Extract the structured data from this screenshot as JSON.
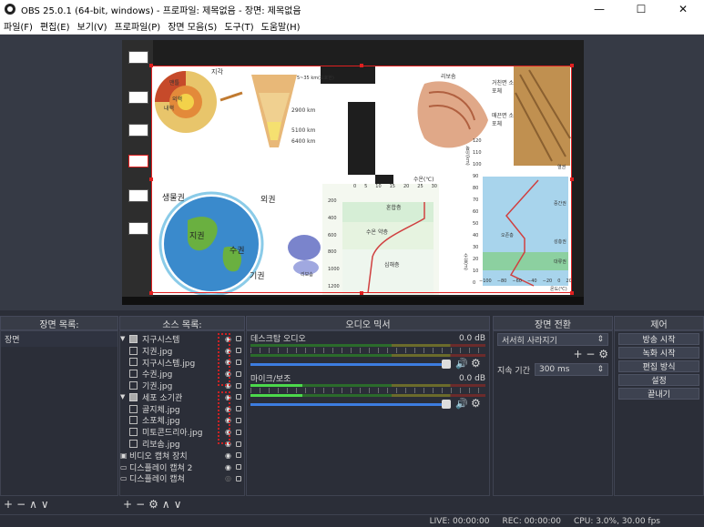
{
  "window": {
    "title": "OBS 25.0.1 (64-bit, windows) - 프로파일: 제목없음 - 장면: 제목없음",
    "minimize": "—",
    "maximize": "☐",
    "close": "✕"
  },
  "menu": [
    "파일(F)",
    "편집(E)",
    "보기(V)",
    "프로파일(P)",
    "장면 모음(S)",
    "도구(T)",
    "도움말(H)"
  ],
  "preview": {
    "slide_labels": {
      "crust": "지각",
      "crust_depth": "5~35 km(오호한)",
      "mantle": "맨틀",
      "outer_core": "외핵",
      "inner_core": "내핵",
      "d2900": "2900 km",
      "d5100": "5100 km",
      "d6400": "6400 km",
      "biosphere": "생물권",
      "geosphere": "지권",
      "hydrosphere": "수권",
      "atmosphere": "기권",
      "outer": "외권",
      "ribosome": "리보솜",
      "rough_er": "거친면 소포체",
      "smooth_er": "매끈면 소포체",
      "temp_label": "수온(℃)",
      "temp_ticks": [
        "0",
        "5",
        "10",
        "15",
        "20",
        "25",
        "30"
      ],
      "depth_ticks": [
        "200",
        "400",
        "600",
        "800",
        "1000",
        "1200"
      ],
      "depth_label": "수심(m)",
      "mixed": "혼합층",
      "thermocline": "수온 약층",
      "deep": "심해층",
      "atm_ticks": [
        "120",
        "110",
        "100",
        "90",
        "80",
        "70",
        "60",
        "50",
        "40",
        "30",
        "20",
        "10",
        "0"
      ],
      "atm_ylabel": "높이(km)",
      "thermosphere": "열권",
      "mesosphere": "중간권",
      "ozone": "오존층",
      "stratosphere": "성층권",
      "troposphere": "대류권",
      "atm_xticks": [
        "−100",
        "−80",
        "−60",
        "−40",
        "−20",
        "0",
        "20"
      ],
      "atm_xlabel": "온도(℃)"
    }
  },
  "scenes": {
    "header": "장면 목록:",
    "items": [
      "장면"
    ]
  },
  "sources": {
    "header": "소스 목록:",
    "items": [
      {
        "name": "지구시스템",
        "type": "folder",
        "indent": 0
      },
      {
        "name": "지권.jpg",
        "type": "image",
        "indent": 1
      },
      {
        "name": "지구시스템.jpg",
        "type": "image",
        "indent": 1
      },
      {
        "name": "수권.jpg",
        "type": "image",
        "indent": 1
      },
      {
        "name": "기권.jpg",
        "type": "image",
        "indent": 1
      },
      {
        "name": "세포 소기관",
        "type": "folder",
        "indent": 0
      },
      {
        "name": "골지체.jpg",
        "type": "image",
        "indent": 1
      },
      {
        "name": "소포체.jpg",
        "type": "image",
        "indent": 1
      },
      {
        "name": "미토콘드리아.jpg",
        "type": "image",
        "indent": 1
      },
      {
        "name": "리보솜.jpg",
        "type": "image",
        "indent": 1
      },
      {
        "name": "비디오 캡쳐 장치",
        "type": "camera",
        "indent": 0
      },
      {
        "name": "디스플레이 캡쳐 2",
        "type": "display",
        "indent": 0
      },
      {
        "name": "디스플레이 캡쳐",
        "type": "display",
        "indent": 0
      }
    ]
  },
  "mixer": {
    "header": "오디오 믹서",
    "channels": [
      {
        "name": "데스크탑 오디오",
        "db": "0.0 dB"
      },
      {
        "name": "마이크/보조",
        "db": "0.0 dB"
      }
    ]
  },
  "transitions": {
    "header": "장면 전환",
    "selected": "서서히 사라지기",
    "duration_label": "지속 기간",
    "duration_value": "300 ms"
  },
  "controls": {
    "header": "제어",
    "buttons": [
      "방송 시작",
      "녹화 시작",
      "편집 방식",
      "설정",
      "끝내기"
    ]
  },
  "status": {
    "live": "LIVE: 00:00:00",
    "rec": "REC: 00:00:00",
    "cpu": "CPU: 3.0%, 30.00 fps"
  },
  "colors": {
    "accent": "#3d7de0",
    "selection": "#e02020",
    "highlight": "#cc2222"
  }
}
